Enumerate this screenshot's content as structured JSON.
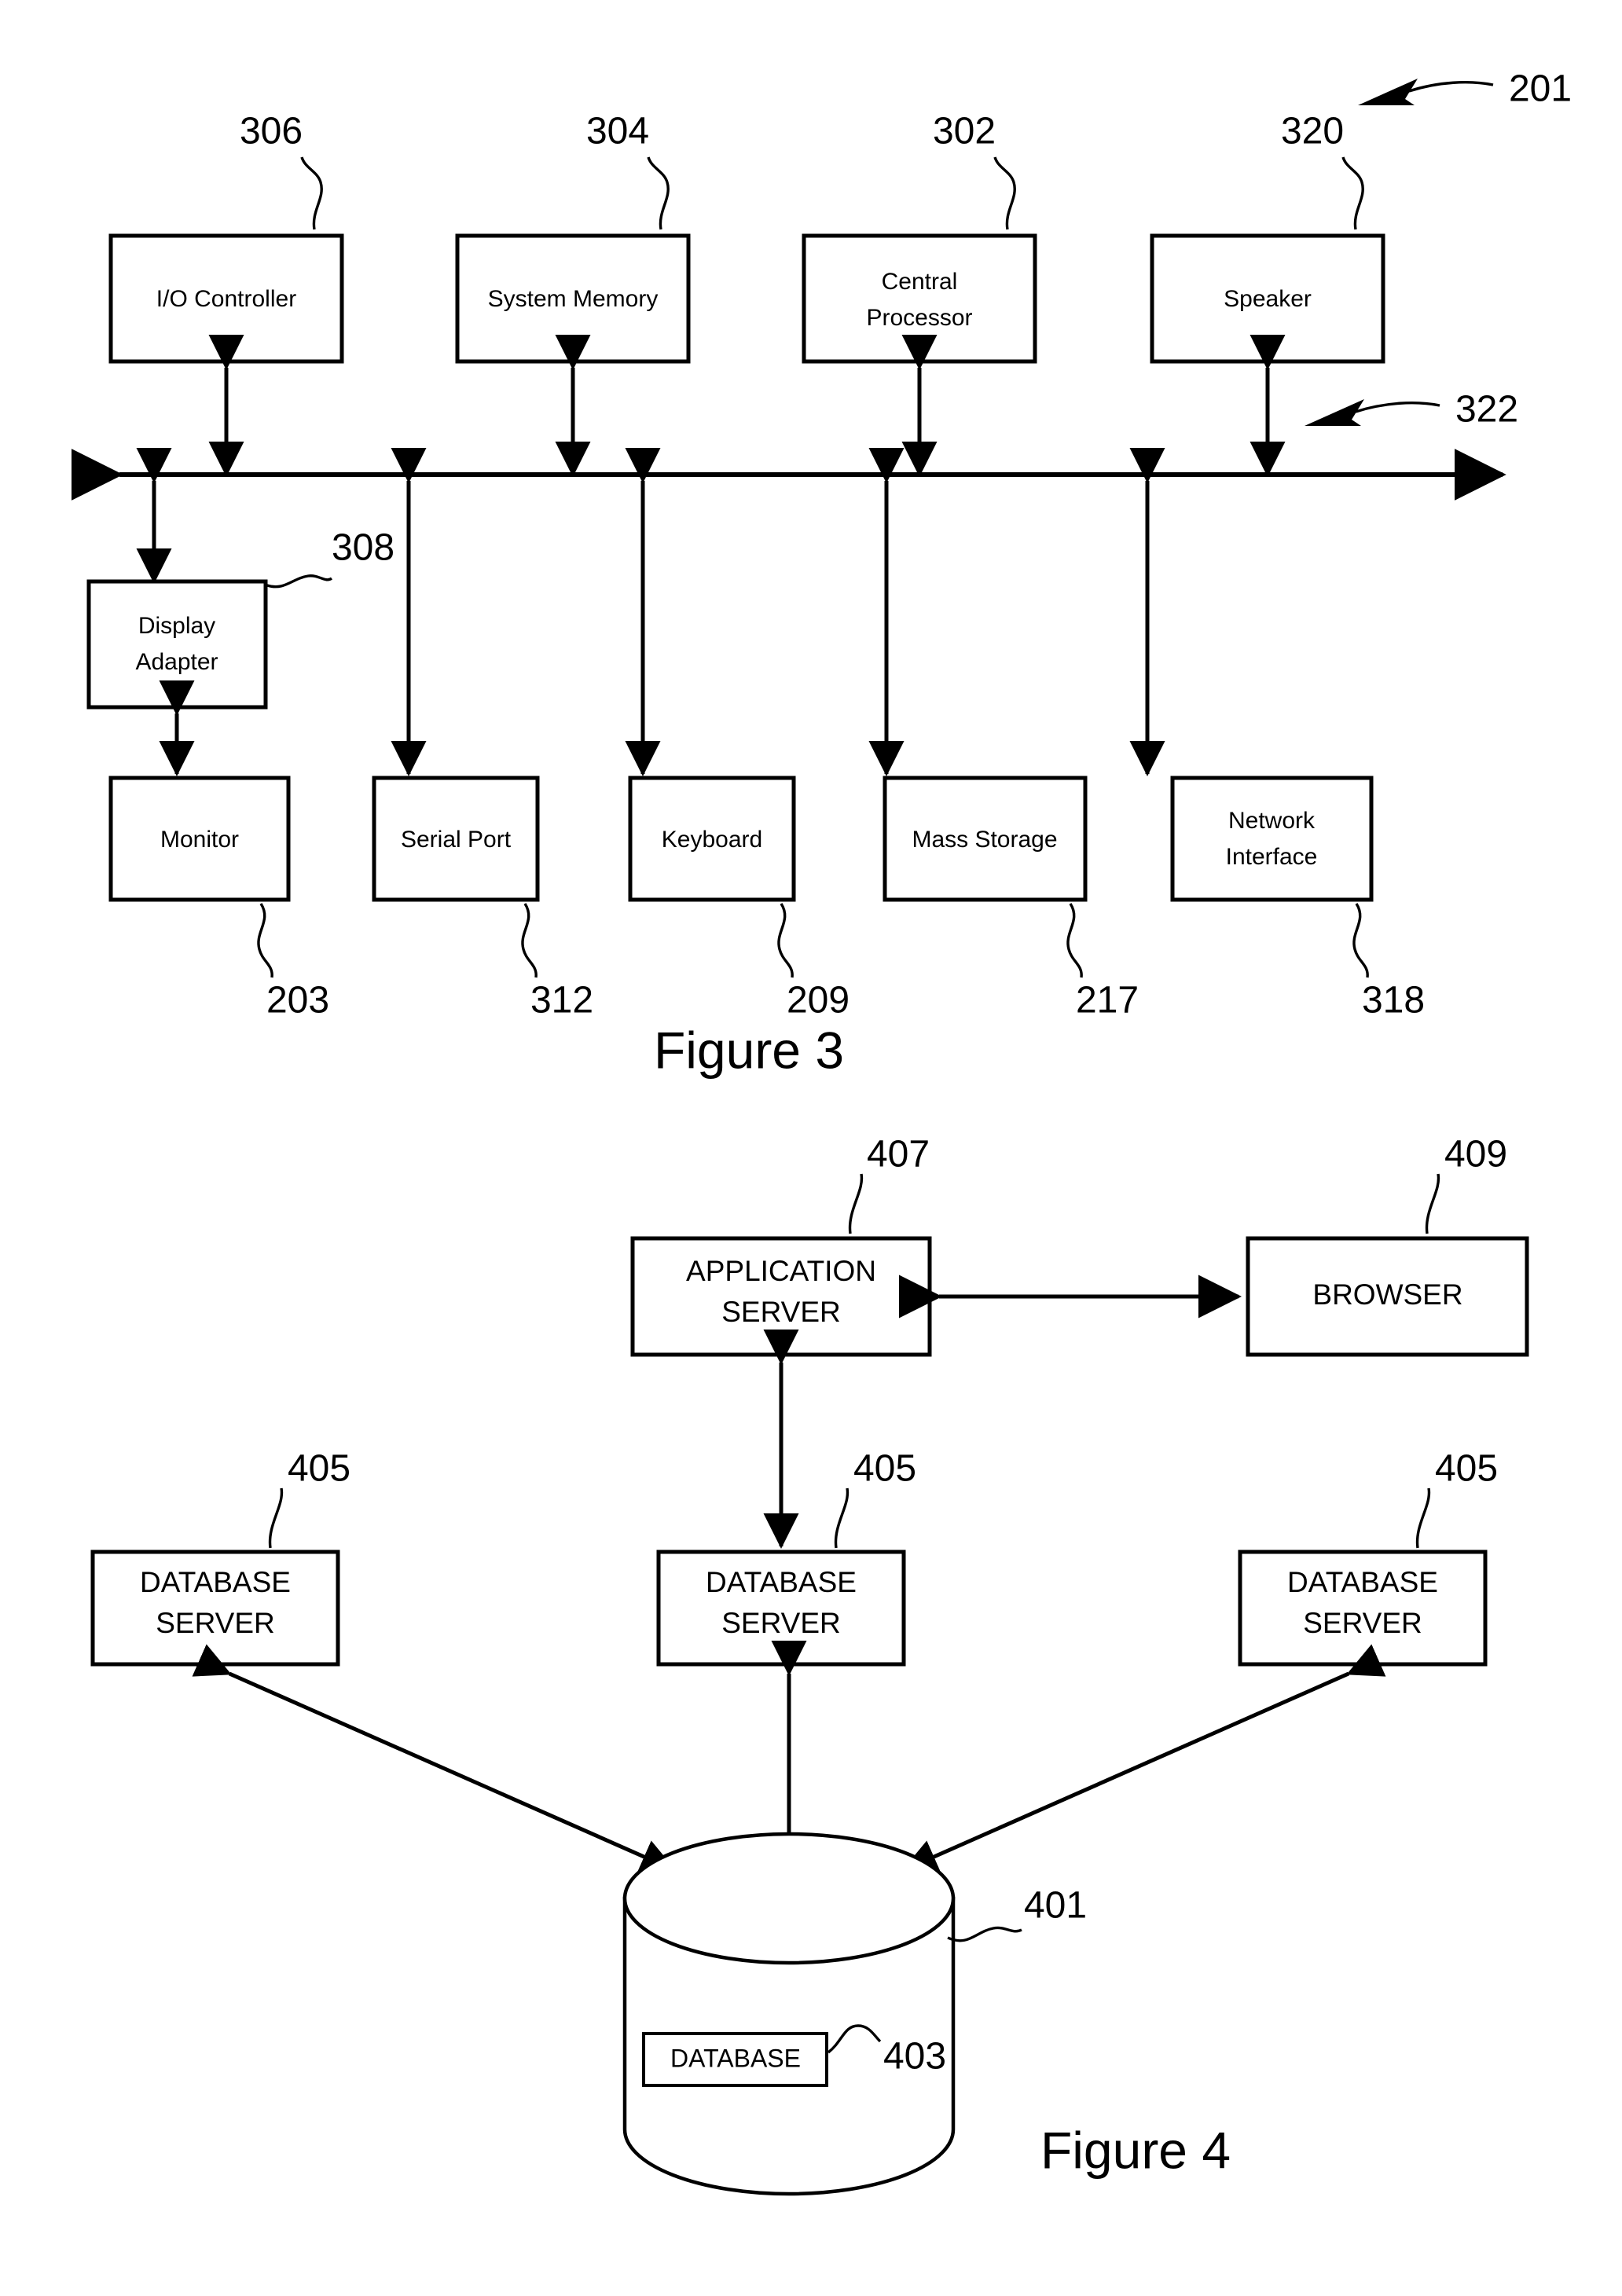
{
  "figure3": {
    "caption": "Figure 3",
    "system_ref": "201",
    "bus_ref": "322",
    "top_row": [
      {
        "label": "I/O Controller",
        "ref": "306",
        "lines": [
          "I/O Controller"
        ]
      },
      {
        "label": "System Memory",
        "ref": "304",
        "lines": [
          "System Memory"
        ]
      },
      {
        "label": "Central Processor",
        "ref": "302",
        "lines": [
          "Central",
          "Processor"
        ]
      },
      {
        "label": "Speaker",
        "ref": "320",
        "lines": [
          "Speaker"
        ]
      }
    ],
    "display_adapter": {
      "label": "Display Adapter",
      "ref": "308",
      "lines": [
        "Display",
        "Adapter"
      ]
    },
    "bottom_row": [
      {
        "label": "Monitor",
        "ref": "203",
        "lines": [
          "Monitor"
        ]
      },
      {
        "label": "Serial Port",
        "ref": "312",
        "lines": [
          "Serial Port"
        ]
      },
      {
        "label": "Keyboard",
        "ref": "209",
        "lines": [
          "Keyboard"
        ]
      },
      {
        "label": "Mass Storage",
        "ref": "217",
        "lines": [
          "Mass Storage"
        ]
      },
      {
        "label": "Network Interface",
        "ref": "318",
        "lines": [
          "Network",
          "Interface"
        ]
      }
    ]
  },
  "figure4": {
    "caption": "Figure 4",
    "application_server": {
      "label": "APPLICATION SERVER",
      "ref": "407",
      "lines": [
        "APPLICATION",
        "SERVER"
      ]
    },
    "browser": {
      "label": "BROWSER",
      "ref": "409",
      "lines": [
        "BROWSER"
      ]
    },
    "database_servers": [
      {
        "label": "DATABASE SERVER",
        "ref": "405",
        "lines": [
          "DATABASE",
          "SERVER"
        ]
      },
      {
        "label": "DATABASE SERVER",
        "ref": "405",
        "lines": [
          "DATABASE",
          "SERVER"
        ]
      },
      {
        "label": "DATABASE SERVER",
        "ref": "405",
        "lines": [
          "DATABASE",
          "SERVER"
        ]
      }
    ],
    "datastore": {
      "label": "DATABASE",
      "cylinder_ref": "401",
      "inner_ref": "403"
    }
  },
  "colors": {
    "ink": "#000000",
    "paper": "#ffffff"
  }
}
